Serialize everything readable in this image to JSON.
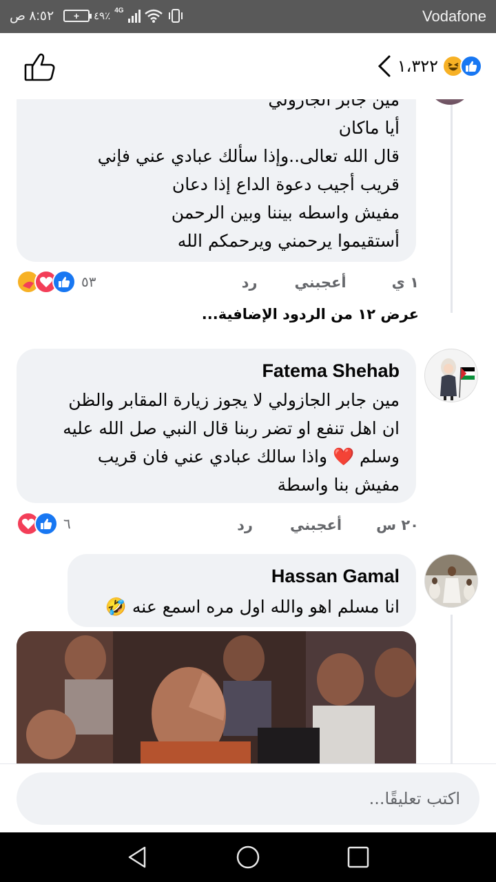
{
  "status_bar": {
    "carrier": "Vodafone",
    "time": "٨:٥٢ ص",
    "battery": "+",
    "battery_percent": "٤٩٪",
    "network": "4G"
  },
  "header": {
    "reaction_count": "١،٣٢٢",
    "reaction_icons": [
      "like-reaction-icon",
      "haha-reaction-icon"
    ]
  },
  "comments": [
    {
      "author": "",
      "lines": [
        "مين جابر الجازولي",
        "أيا ماكان",
        "قال الله تعالى..وإذا سألك عبادي عني فإني",
        "قريب أجيب دعوة الداع إذا دعان",
        "مفيش واسطه بيننا وبين الرحمن",
        "أستقيموا يرحمني ويرحمكم الله"
      ],
      "time": "١ ي",
      "like_label": "أعجبني",
      "reply_label": "رد",
      "reactions_count": "٥٣",
      "reaction_icons": [
        "like-reaction-icon",
        "love-reaction-icon",
        "care-reaction-icon"
      ]
    },
    {
      "author": "Fatema Shehab",
      "lines": [
        "مين جابر الجازولي لا يجوز زيارة المقابر والظن",
        "ان اهل تنفع او تضر ربنا قال النبي صل الله عليه",
        "وسلم ❤️ واذا سالك عبادي عني فان قريب",
        "مفيش بنا واسطة"
      ],
      "time": "٢٠ س",
      "like_label": "أعجبني",
      "reply_label": "رد",
      "reactions_count": "٦",
      "reaction_icons": [
        "like-reaction-icon",
        "love-reaction-icon"
      ]
    },
    {
      "author": "Hassan Gamal",
      "lines": [
        "انا مسلم اهو والله اول مره اسمع عنه 🤣"
      ],
      "attachment": "gif-image"
    }
  ],
  "more_replies_label": "عرض ١٢ من الردود الإضافية...",
  "comment_input": {
    "placeholder": "اكتب تعليقًا..."
  },
  "colors": {
    "status_bar_bg": "#595959",
    "bubble_bg": "#f0f2f5",
    "like_blue": "#1877f2",
    "love_red": "#f33e58",
    "haha_yellow": "#f7b125",
    "meta_gray": "#65676b"
  }
}
